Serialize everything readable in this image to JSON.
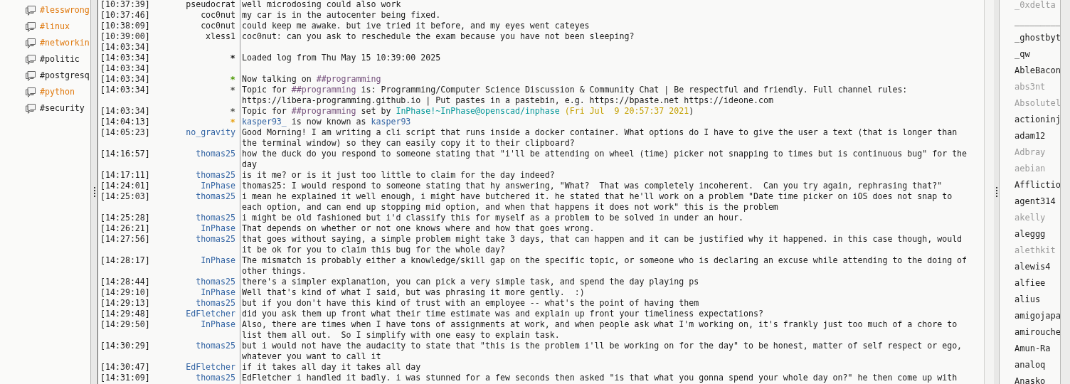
{
  "channels": [
    {
      "name": "#lesswrong",
      "activity": true
    },
    {
      "name": "#linux",
      "activity": true
    },
    {
      "name": "#networkin",
      "activity": true
    },
    {
      "name": "#politic",
      "activity": false
    },
    {
      "name": "#postgresq",
      "activity": false
    },
    {
      "name": "#python",
      "activity": true
    },
    {
      "name": "#security",
      "activity": false
    }
  ],
  "messages": [
    {
      "time": "[10:37:39]",
      "nick": "pseudocrat",
      "color": "#1a1a1a",
      "parts": [
        {
          "text": "well microdosing could also work"
        }
      ]
    },
    {
      "time": "[10:37:46]",
      "nick": "coc0nut",
      "color": "#1a1a1a",
      "parts": [
        {
          "text": "my car is in the autocenter being fixed."
        }
      ]
    },
    {
      "time": "[10:38:09]",
      "nick": "coc0nut",
      "color": "#1a1a1a",
      "parts": [
        {
          "text": "could keep me awake. but ive tried it before, and my eyes went cateyes"
        }
      ]
    },
    {
      "time": "[10:39:00]",
      "nick": "xless1",
      "color": "#1a1a1a",
      "parts": [
        {
          "text": "coc0nut: can you ask to reschedule the exam because you have not been sleeping?"
        }
      ]
    },
    {
      "time": "[14:03:34]"
    },
    {
      "time": "[14:03:34]",
      "nick": "*",
      "parts": [
        {
          "text": "Loaded log from Thu May 15 10:39:00 2025"
        }
      ]
    },
    {
      "time": "[14:03:34]"
    },
    {
      "time": "[14:03:34]",
      "nick": "*",
      "color": "#4e9a06",
      "parts": [
        {
          "text": "Now talking on "
        },
        {
          "text": "##programming",
          "color": "#75507b"
        }
      ]
    },
    {
      "time": "[14:03:34]",
      "nick": "*",
      "color": "#555753",
      "parts": [
        {
          "text": "Topic for "
        },
        {
          "text": "##programming",
          "color": "#75507b"
        },
        {
          "text": " is: Programming/Computer Science Discussion & Community Chat | Be respectful and friendly. Full channel rules: https://libera-programming.github.io | Put pastes in a pastebin, e.g. https://bpaste.net https://ideone.com"
        }
      ]
    },
    {
      "time": "[14:03:34]",
      "nick": "*",
      "color": "#555753",
      "parts": [
        {
          "text": "Topic for "
        },
        {
          "text": "##programming",
          "color": "#75507b"
        },
        {
          "text": " set by "
        },
        {
          "text": "InPhase!~InPhase@openscad/inphase",
          "color": "#06989a"
        },
        {
          "text": " (Fri Jul  9 20:57:37 2021",
          "color": "#c4a000"
        },
        {
          "text": ")"
        }
      ]
    },
    {
      "time": "[14:04:13]",
      "nick": "*",
      "color": "#e8a317",
      "parts": [
        {
          "text": "kasper93_",
          "color": "#3465a4"
        },
        {
          "text": " is now known as "
        },
        {
          "text": "kasper93",
          "color": "#3465a4"
        }
      ]
    },
    {
      "time": "[14:05:23]",
      "nick": "no_gravity",
      "color": "#3465a4",
      "parts": [
        {
          "text": "Good Morning! I am writing a cli script that runs inside a docker container. What options do I have to give the user a text (that is longer than the terminal window) so they can easily copy it to their clipboard?"
        }
      ]
    },
    {
      "time": "[14:16:57]",
      "nick": "thomas25",
      "color": "#3465a4",
      "parts": [
        {
          "text": "how the duck do you respond to someone stating that \"i'll be attending on wheel (time) picker not snapping to times but is continuous bug\" for the day"
        }
      ]
    },
    {
      "time": "[14:17:11]",
      "nick": "thomas25",
      "color": "#3465a4",
      "parts": [
        {
          "text": "is it me? or is it just too little to claim for the day indeed?"
        }
      ]
    },
    {
      "time": "[14:24:01]",
      "nick": "InPhase",
      "color": "#3465a4",
      "parts": [
        {
          "text": "thomas25: I would respond to someone stating that hy answering, \"What?  That was completely incoherent.  Can you try again, rephrasing that?\""
        }
      ]
    },
    {
      "time": "[14:25:03]",
      "nick": "thomas25",
      "color": "#3465a4",
      "parts": [
        {
          "text": "i mean he explained it well enough, i might have butchered it. he stated that he'll work on a problem \"Date time picker on iOS does not snap to each option, and can end up stopping mid option, and when that happens it does not work\" this is the problem"
        }
      ]
    },
    {
      "time": "[14:25:28]",
      "nick": "thomas25",
      "color": "#3465a4",
      "parts": [
        {
          "text": "i might be old fashioned but i'd classify this for myself as a problem to be solved in under an hour."
        }
      ]
    },
    {
      "time": "[14:26:21]",
      "nick": "InPhase",
      "color": "#3465a4",
      "parts": [
        {
          "text": "That depends on whether or not one knows where and how that goes wrong."
        }
      ]
    },
    {
      "time": "[14:27:56]",
      "nick": "thomas25",
      "color": "#3465a4",
      "parts": [
        {
          "text": "that goes without saying, a simple problem might take 3 days, that can happen and it can be justified why it happened. in this case though, would it be ok for you to claim this bug for the whole day?"
        }
      ]
    },
    {
      "time": "[14:28:17]",
      "nick": "InPhase",
      "color": "#3465a4",
      "parts": [
        {
          "text": "The mismatch is probably either a knowledge/skill gap on the specific topic, or someone who is declaring an excuse while attending to the doing of other things."
        }
      ]
    },
    {
      "time": "[14:28:44]",
      "nick": "thomas25",
      "color": "#3465a4",
      "parts": [
        {
          "text": "there's a simpler explanation, you can pick a very simple task, and spend the day playing ps"
        }
      ]
    },
    {
      "time": "[14:29:10]",
      "nick": "InPhase",
      "color": "#3465a4",
      "parts": [
        {
          "text": "Well that's kind of what I said, but was phrasing it more gently.  :)"
        }
      ]
    },
    {
      "time": "[14:29:13]",
      "nick": "thomas25",
      "color": "#3465a4",
      "parts": [
        {
          "text": "but if you don't have this kind of trust with an employee -- what's the point of having them"
        }
      ]
    },
    {
      "time": "[14:29:48]",
      "nick": "EdFletcher",
      "color": "#3465a4",
      "parts": [
        {
          "text": "did you ask them up front what their time estimate was and explain up front your timeliness expectations?"
        }
      ]
    },
    {
      "time": "[14:29:50]",
      "nick": "InPhase",
      "color": "#3465a4",
      "parts": [
        {
          "text": "Also, there are times when I have tons of assignments at work, and when people ask what I'm working on, it's frankly just too much of a chore to list them all out.  So I simplify with one easy to explain task."
        }
      ]
    },
    {
      "time": "[14:30:29]",
      "nick": "thomas25",
      "color": "#3465a4",
      "parts": [
        {
          "text": "but i would not have the audacity to state that \"this is the problem i'll be working on for the day\" to be honest, matter of self respect or ego, whatever you want to call it"
        }
      ]
    },
    {
      "time": "[14:30:47]",
      "nick": "EdFletcher",
      "color": "#3465a4",
      "parts": [
        {
          "text": "if it takes all day it takes all day"
        }
      ]
    },
    {
      "time": "[14:31:09]",
      "nick": "thomas25",
      "color": "#3465a4",
      "parts": [
        {
          "text": "EdFletcher i handled it badly. i was stunned for a few seconds then asked \"is that what you gonna spend your whole day on?\" he then come up with"
        }
      ]
    }
  ],
  "users": [
    {
      "name": "_0xdelta",
      "away": true
    },
    {
      "name": "_________",
      "away": false
    },
    {
      "name": "_ghostbyt",
      "away": false
    },
    {
      "name": "_qw",
      "away": false
    },
    {
      "name": "AbleBacon",
      "away": false
    },
    {
      "name": "abs3nt",
      "away": true
    },
    {
      "name": "Absolutel",
      "away": true
    },
    {
      "name": "actioninj",
      "away": false
    },
    {
      "name": "adam12",
      "away": false
    },
    {
      "name": "Adbray",
      "away": true
    },
    {
      "name": "aebian",
      "away": true
    },
    {
      "name": "Afflictio",
      "away": false
    },
    {
      "name": "agent314",
      "away": false
    },
    {
      "name": "akelly",
      "away": true
    },
    {
      "name": "aleggg",
      "away": false
    },
    {
      "name": "alethkit",
      "away": true
    },
    {
      "name": "alewis4",
      "away": false
    },
    {
      "name": "alfiee",
      "away": false
    },
    {
      "name": "alius",
      "away": false
    },
    {
      "name": "amigojapa",
      "away": false
    },
    {
      "name": "amirouche",
      "away": false
    },
    {
      "name": "Amun-Ra",
      "away": false
    },
    {
      "name": "analoq",
      "away": false
    },
    {
      "name": "Anasko",
      "away": false
    }
  ]
}
